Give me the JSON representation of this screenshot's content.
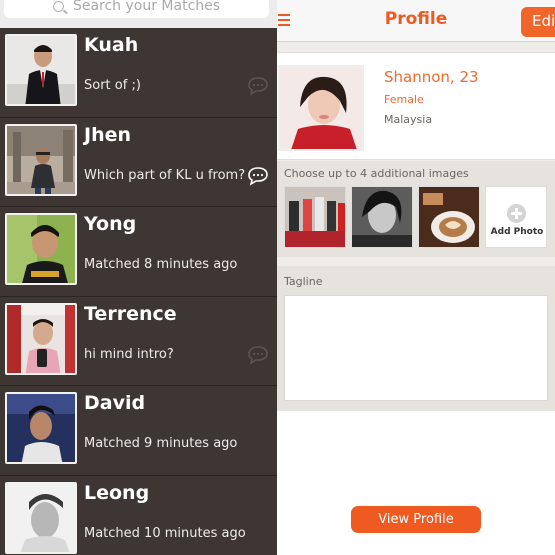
{
  "search": {
    "placeholder": "Search your Matches"
  },
  "matches": [
    {
      "name": "Kuah",
      "message": "Sort of ;)",
      "chat_icon": "chat-bubble-icon",
      "unread": false
    },
    {
      "name": "Jhen",
      "message": "Which part of KL u from?",
      "chat_icon": "chat-bubble-icon",
      "unread": true
    },
    {
      "name": "Yong",
      "message": "Matched 8 minutes ago"
    },
    {
      "name": "Terrence",
      "message": "hi mind intro?",
      "chat_icon": "chat-bubble-icon",
      "unread": false
    },
    {
      "name": "David",
      "message": "Matched 9 minutes ago"
    },
    {
      "name": "Leong",
      "message": "Matched 10 minutes ago"
    }
  ],
  "profile_header": {
    "title": "Profile",
    "edit_label": "Edit",
    "menu_icon": "hamburger-icon"
  },
  "profile": {
    "name_age": "Shannon, 23",
    "gender": "Female",
    "country": "Malaysia"
  },
  "images": {
    "label": "Choose up to 4 additional images",
    "add_photo_label": "Add Photo"
  },
  "tagline": {
    "label": "Tagline",
    "value": ""
  },
  "actions": {
    "view_profile_label": "View Profile"
  },
  "colors": {
    "accent": "#ef5a22",
    "list_bg": "#3d3632",
    "panel_bg": "#e6e2dd"
  }
}
